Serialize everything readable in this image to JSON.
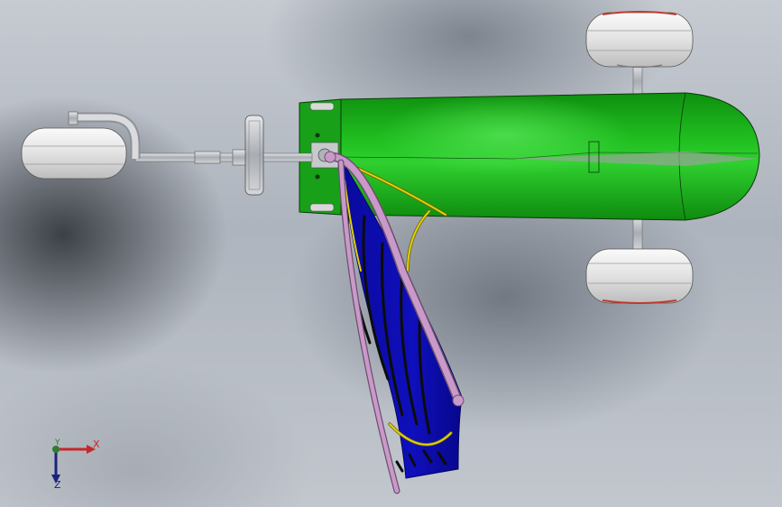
{
  "window": {
    "title": ""
  },
  "orientation_triad": {
    "x_label": "X",
    "y_label": "Y",
    "z_label": "Z",
    "colors": {
      "x": "#c62828",
      "y": "#2e7d32",
      "z": "#1a237e"
    }
  },
  "colors": {
    "hull": "#14a814",
    "hull_highlight": "#34d634",
    "wheel": "#e6e6e6",
    "wheel_rim": "#c0392b",
    "sail": "#0a0aa8",
    "ribs": "#101010",
    "boom": "#c79ac7",
    "trim_line": "#e0d010",
    "metal": "#b8bcc2"
  },
  "model_parts": [
    "hull",
    "left-rear-wheel",
    "right-rear-wheel",
    "front-wheel",
    "front-fork",
    "steering-shaft",
    "mast-boom",
    "wing-sail",
    "sail-ribs",
    "trim-line"
  ]
}
